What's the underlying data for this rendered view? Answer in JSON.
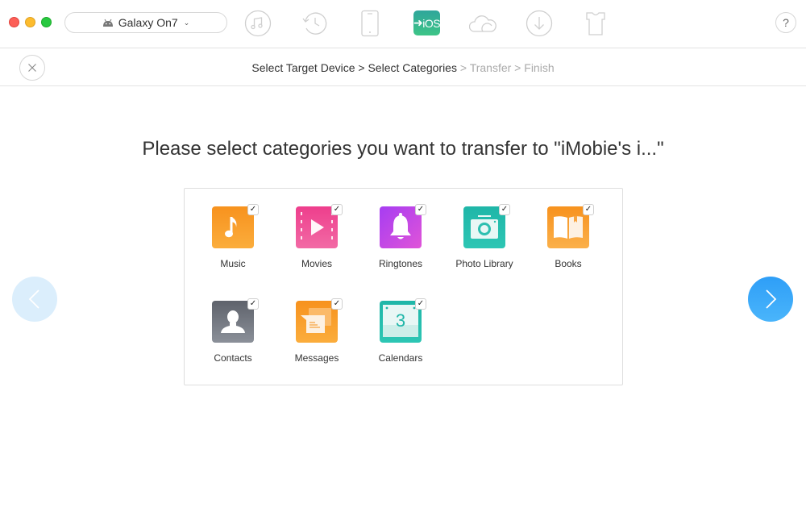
{
  "window": {
    "device_selector": {
      "label": "Galaxy On7",
      "icon": "android-icon"
    }
  },
  "toolbar": {
    "items": [
      {
        "name": "music-manager",
        "icon": "music-note-icon"
      },
      {
        "name": "backup-history",
        "icon": "history-icon"
      },
      {
        "name": "device-manager",
        "icon": "phone-icon"
      },
      {
        "name": "to-ios",
        "icon": "to-ios-icon",
        "label": "iOS",
        "active": true
      },
      {
        "name": "cloud",
        "icon": "cloud-icon"
      },
      {
        "name": "downloader",
        "icon": "download-icon"
      },
      {
        "name": "toolkit",
        "icon": "tshirt-icon"
      }
    ],
    "help_label": "?"
  },
  "breadcrumb": {
    "steps": [
      {
        "label": "Select Target Device",
        "state": "done"
      },
      {
        "label": "Select Categories",
        "state": "done"
      },
      {
        "label": "Transfer",
        "state": "pending"
      },
      {
        "label": "Finish",
        "state": "pending"
      }
    ],
    "separator": " > "
  },
  "headline": "Please select categories you want to transfer to \"iMobie's i...\"",
  "categories": [
    {
      "label": "Music",
      "checked": true,
      "color_top": "#f7921e",
      "color_bottom": "#fbad3c"
    },
    {
      "label": "Movies",
      "checked": true,
      "color_top": "#ee3e8c",
      "color_bottom": "#f26aa5"
    },
    {
      "label": "Ringtones",
      "checked": true,
      "color_top": "#a63df2",
      "color_bottom": "#e054d8"
    },
    {
      "label": "Photo Library",
      "checked": true,
      "color_top": "#1fb6a8",
      "color_bottom": "#2dc6b4"
    },
    {
      "label": "Books",
      "checked": true,
      "color_top": "#f7921e",
      "color_bottom": "#fbb04a"
    },
    {
      "label": "Contacts",
      "checked": true,
      "color_top": "#5e626b",
      "color_bottom": "#8b9099"
    },
    {
      "label": "Messages",
      "checked": true,
      "color_top": "#f7921e",
      "color_bottom": "#fbad3c"
    },
    {
      "label": "Calendars",
      "checked": true,
      "color_top": "#1fb6a8",
      "color_bottom": "#2dc6b4",
      "day": "3"
    }
  ],
  "check_glyph": "✓",
  "nav": {
    "prev": {
      "icon": "chevron-left-icon",
      "enabled": false
    },
    "next": {
      "icon": "chevron-right-icon",
      "enabled": true
    }
  },
  "colors": {
    "accent_blue": "#2e9ef7",
    "ios_green": "#3dc487",
    "pending_text": "#aaaaaa"
  }
}
